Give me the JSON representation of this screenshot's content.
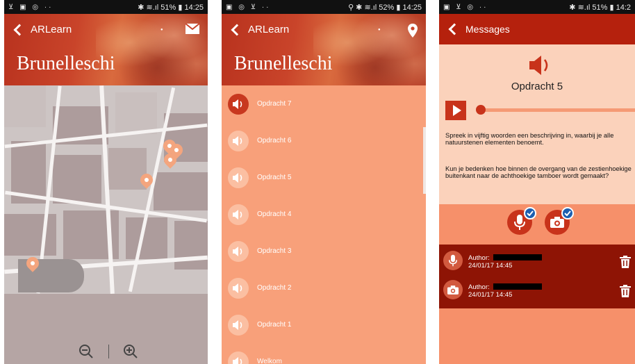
{
  "screens": {
    "map": {
      "status": {
        "left": "⊻ ▣ ◎ ··",
        "right": "✱ ≋.ıl 51% ▮ 14:25"
      },
      "header": {
        "back_label": "ARLearn",
        "dot": "●",
        "title": "Brunelleschi",
        "right_icon": "envelope-icon"
      },
      "zoom": {
        "out_icon": "zoom-out-icon",
        "in_icon": "zoom-in-icon"
      }
    },
    "list": {
      "status": {
        "left": "▣ ◎ ⊻ ··",
        "right": "⚲ ✱ ≋.ıl 52% ▮ 14:25"
      },
      "header": {
        "back_label": "ARLearn",
        "dot": "●",
        "title": "Brunelleschi",
        "right_icon": "location-pin-icon"
      },
      "items": [
        {
          "label": "Opdracht 7",
          "active": true
        },
        {
          "label": "Opdracht 6",
          "active": false
        },
        {
          "label": "Opdracht 5",
          "active": false
        },
        {
          "label": "Opdracht 4",
          "active": false
        },
        {
          "label": "Opdracht 3",
          "active": false
        },
        {
          "label": "Opdracht 2",
          "active": false
        },
        {
          "label": "Opdracht 1",
          "active": false
        },
        {
          "label": "Welkom",
          "active": false
        }
      ]
    },
    "messages": {
      "status": {
        "left": "▣ ⊻ ◎ ··",
        "right": "✱ ≋.ıl 51% ▮ 14:2"
      },
      "header": {
        "back_label": "Messages"
      },
      "task": {
        "title": "Opdracht 5",
        "question_1": "Spreek in vijftig woorden een beschrijving in, waarbij je alle natuurstenen elementen benoemt.",
        "question_2": "Kun je bedenken hoe binnen de overgang van de zestienhoekige buitenkant naar de achthoekige tamboer wordt gemaakt?"
      },
      "messages": [
        {
          "type": "audio",
          "author_label": "Author:",
          "timestamp": "24/01/17 14:45"
        },
        {
          "type": "photo",
          "author_label": "Author:",
          "timestamp": "24/01/17 14:45"
        }
      ]
    }
  },
  "colors": {
    "header_red": "#b5210d",
    "list_orange": "#f8a07a",
    "active_red": "#c8381f",
    "peach": "#fbd2bb",
    "dark_red": "#8e1405",
    "check_blue": "#1c5fb0",
    "pin": "#f4a57e"
  }
}
